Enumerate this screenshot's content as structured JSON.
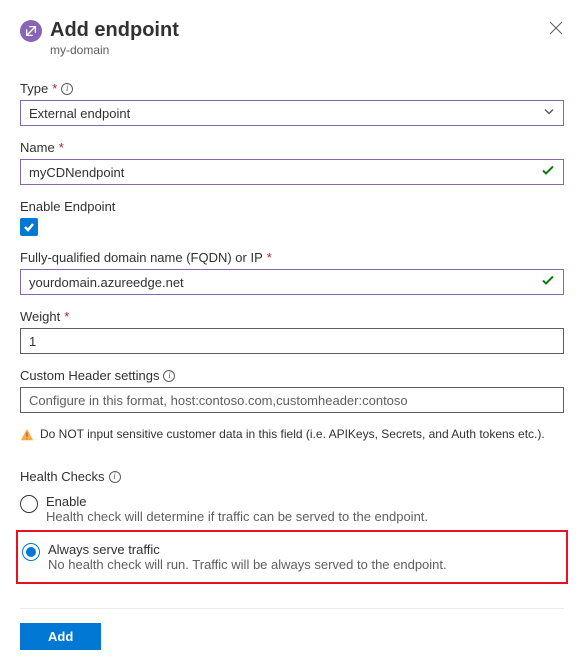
{
  "header": {
    "title": "Add endpoint",
    "subtitle": "my-domain"
  },
  "type": {
    "label": "Type",
    "value": "External endpoint"
  },
  "name": {
    "label": "Name",
    "value": "myCDNendpoint"
  },
  "enable": {
    "label": "Enable Endpoint",
    "checked": true
  },
  "fqdn": {
    "label": "Fully-qualified domain name (FQDN) or IP",
    "value": "yourdomain.azureedge.net"
  },
  "weight": {
    "label": "Weight",
    "value": "1"
  },
  "custom_header": {
    "label": "Custom Header settings",
    "placeholder": "Configure in this format, host:contoso.com,customheader:contoso"
  },
  "warning": "Do NOT input sensitive customer data in this field (i.e. APIKeys, Secrets, and Auth tokens etc.).",
  "health": {
    "label": "Health Checks",
    "options": [
      {
        "label": "Enable",
        "desc": "Health check will determine if traffic can be served to the endpoint."
      },
      {
        "label": "Always serve traffic",
        "desc": "No health check will run. Traffic will be always served to the endpoint."
      }
    ]
  },
  "footer": {
    "add_label": "Add"
  }
}
